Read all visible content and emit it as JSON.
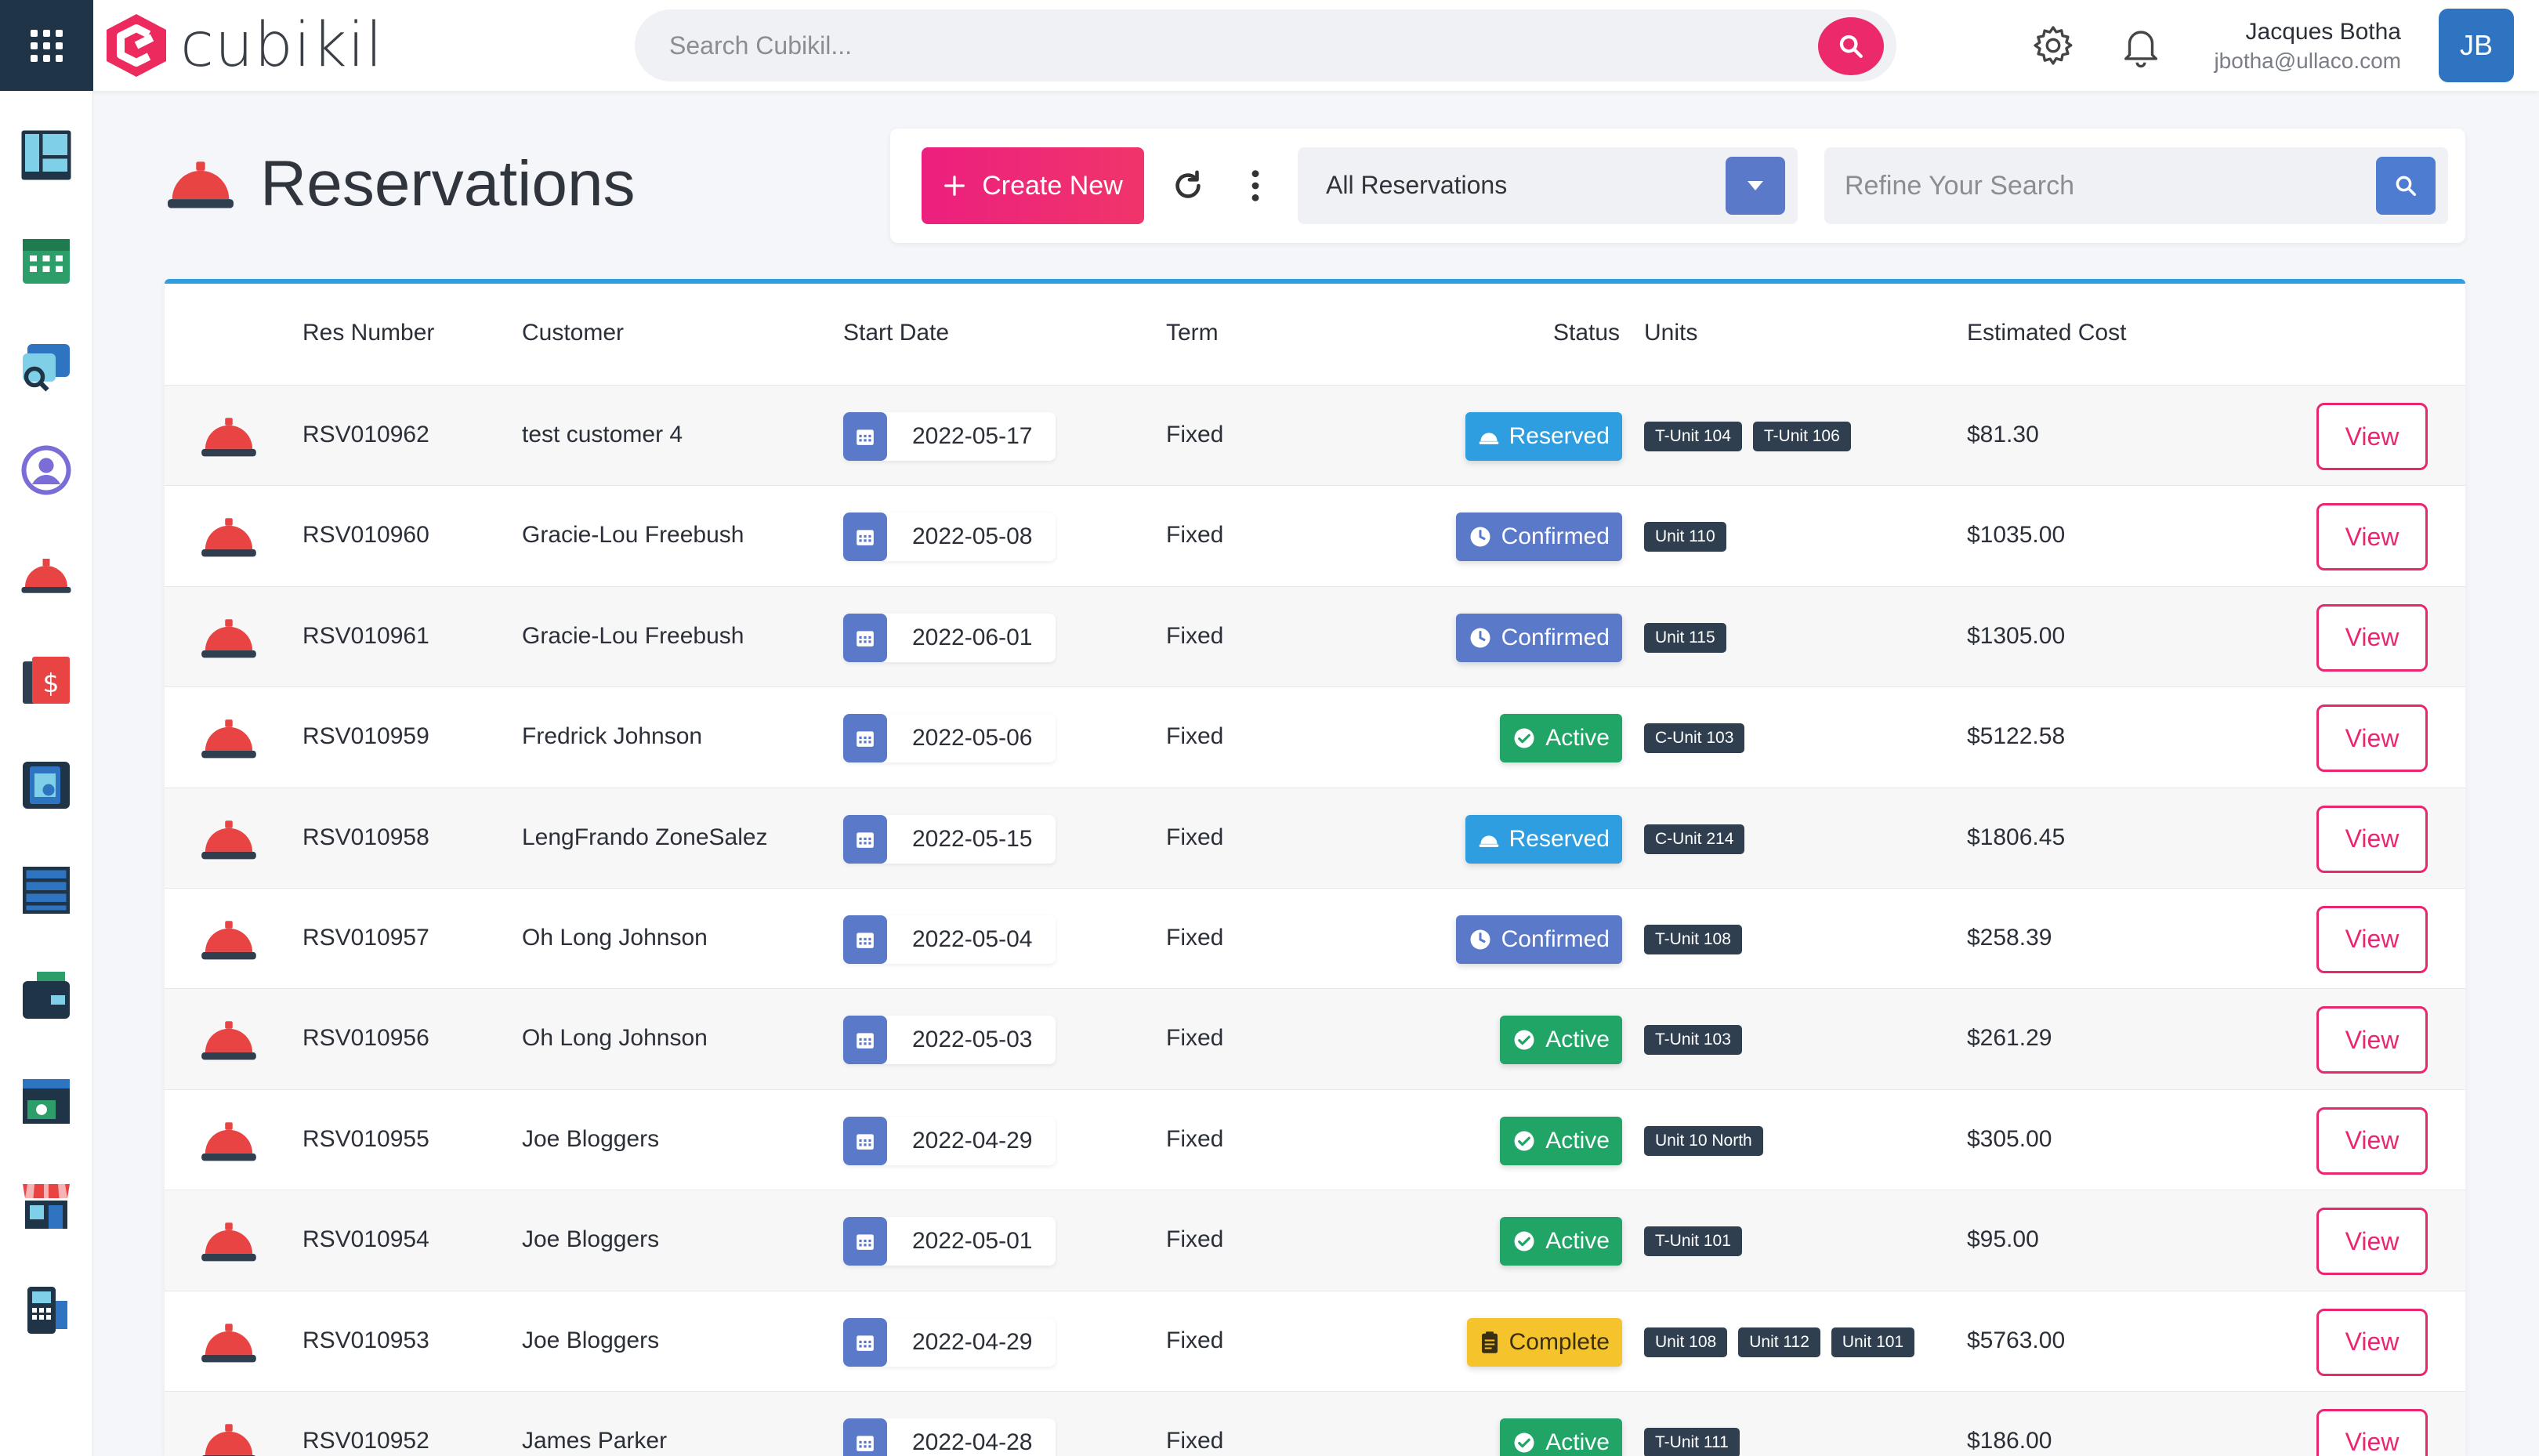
{
  "app": {
    "logo_text": "cubikil",
    "search_placeholder": "Search Cubikil...",
    "user_name": "Jacques Botha",
    "user_email": "jbotha@ullaco.com",
    "user_initials": "JB"
  },
  "sidebar": {
    "items": [
      {
        "icon": "dashboard-icon"
      },
      {
        "icon": "calendar-icon"
      },
      {
        "icon": "search-unit-icon"
      },
      {
        "icon": "customer-icon"
      },
      {
        "icon": "reservation-bell-icon"
      },
      {
        "icon": "invoice-icon"
      },
      {
        "icon": "contract-icon"
      },
      {
        "icon": "units-list-icon"
      },
      {
        "icon": "wallet-icon"
      },
      {
        "icon": "billing-calendar-icon"
      },
      {
        "icon": "store-icon"
      },
      {
        "icon": "pos-terminal-icon"
      }
    ]
  },
  "page": {
    "title": "Reservations",
    "create_label": "Create New",
    "filter_value": "All Reservations",
    "refine_placeholder": "Refine Your Search"
  },
  "table": {
    "headers": {
      "res_number": "Res Number",
      "customer": "Customer",
      "start_date": "Start Date",
      "term": "Term",
      "status": "Status",
      "units": "Units",
      "estimated_cost": "Estimated Cost"
    },
    "view_label": "View",
    "rows": [
      {
        "res": "RSV010962",
        "customer": "test customer 4",
        "date": "2022-05-17",
        "term": "Fixed",
        "status": "Reserved",
        "units": [
          "T-Unit 104",
          "T-Unit 106"
        ],
        "cost": "$81.30"
      },
      {
        "res": "RSV010960",
        "customer": "Gracie-Lou Freebush",
        "date": "2022-05-08",
        "term": "Fixed",
        "status": "Confirmed",
        "units": [
          "Unit 110"
        ],
        "cost": "$1035.00"
      },
      {
        "res": "RSV010961",
        "customer": "Gracie-Lou Freebush",
        "date": "2022-06-01",
        "term": "Fixed",
        "status": "Confirmed",
        "units": [
          "Unit 115"
        ],
        "cost": "$1305.00"
      },
      {
        "res": "RSV010959",
        "customer": "Fredrick Johnson",
        "date": "2022-05-06",
        "term": "Fixed",
        "status": "Active",
        "units": [
          "C-Unit 103"
        ],
        "cost": "$5122.58"
      },
      {
        "res": "RSV010958",
        "customer": "LengFrando ZoneSalez",
        "date": "2022-05-15",
        "term": "Fixed",
        "status": "Reserved",
        "units": [
          "C-Unit 214"
        ],
        "cost": "$1806.45"
      },
      {
        "res": "RSV010957",
        "customer": "Oh Long Johnson",
        "date": "2022-05-04",
        "term": "Fixed",
        "status": "Confirmed",
        "units": [
          "T-Unit 108"
        ],
        "cost": "$258.39"
      },
      {
        "res": "RSV010956",
        "customer": "Oh Long Johnson",
        "date": "2022-05-03",
        "term": "Fixed",
        "status": "Active",
        "units": [
          "T-Unit 103"
        ],
        "cost": "$261.29"
      },
      {
        "res": "RSV010955",
        "customer": "Joe Bloggers",
        "date": "2022-04-29",
        "term": "Fixed",
        "status": "Active",
        "units": [
          "Unit 10 North"
        ],
        "cost": "$305.00"
      },
      {
        "res": "RSV010954",
        "customer": "Joe Bloggers",
        "date": "2022-05-01",
        "term": "Fixed",
        "status": "Active",
        "units": [
          "T-Unit 101"
        ],
        "cost": "$95.00"
      },
      {
        "res": "RSV010953",
        "customer": "Joe Bloggers",
        "date": "2022-04-29",
        "term": "Fixed",
        "status": "Complete",
        "units": [
          "Unit 108",
          "Unit 112",
          "Unit 101"
        ],
        "cost": "$5763.00"
      },
      {
        "res": "RSV010952",
        "customer": "James Parker",
        "date": "2022-04-28",
        "term": "Fixed",
        "status": "Active",
        "units": [
          "T-Unit 111"
        ],
        "cost": "$186.00"
      }
    ]
  },
  "colors": {
    "accent": "#ec2a6b",
    "reserved": "#2e9ee0",
    "confirmed": "#5a79c8",
    "active": "#20a567",
    "complete": "#f5c42c",
    "unit_badge": "#2f3f50"
  }
}
